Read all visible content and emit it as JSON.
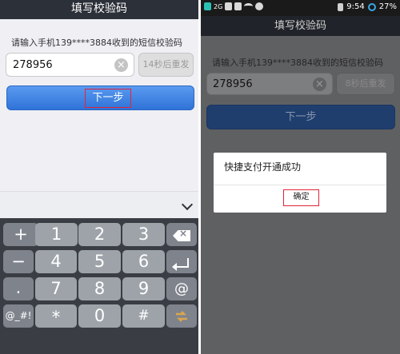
{
  "left": {
    "header_title": "填写校验码",
    "hint": "请输入手机139****3884收到的短信校验码",
    "code_value": "278956",
    "resend_label": "14秒后重发",
    "next_label": "下一步"
  },
  "keyboard": {
    "rows": [
      [
        "+",
        "1",
        "2",
        "3",
        "delete"
      ],
      [
        "-",
        "4",
        "5",
        "6",
        "enter"
      ],
      [
        ".",
        "7",
        "8",
        "9",
        "@"
      ],
      [
        "@_#!",
        "*",
        "0",
        "#",
        "switch"
      ]
    ],
    "key_labels": {
      "plus": "+",
      "k1": "1",
      "k2": "2",
      "k3": "3",
      "minus": "−",
      "k4": "4",
      "k5": "5",
      "k6": "6",
      "dot": ".",
      "k7": "7",
      "k8": "8",
      "k9": "9",
      "at": "@",
      "symbols": "@_#!",
      "star": "*",
      "k0": "0",
      "hash": "#"
    }
  },
  "right": {
    "status": {
      "network": "2G",
      "time": "9:54",
      "battery": "27%"
    },
    "header_title": "填写校验码",
    "hint": "请输入手机139****3884收到的短信校验码",
    "code_value": "278956",
    "resend_label": "8秒后重发",
    "next_label": "下一步",
    "dialog": {
      "message": "快捷支付开通成功",
      "ok_label": "确定"
    }
  },
  "colors": {
    "primary_button": "#2f73d8",
    "highlight_outline": "#e0243a",
    "header_bg": "#2c3039",
    "keyboard_bg": "#3a3d44"
  }
}
